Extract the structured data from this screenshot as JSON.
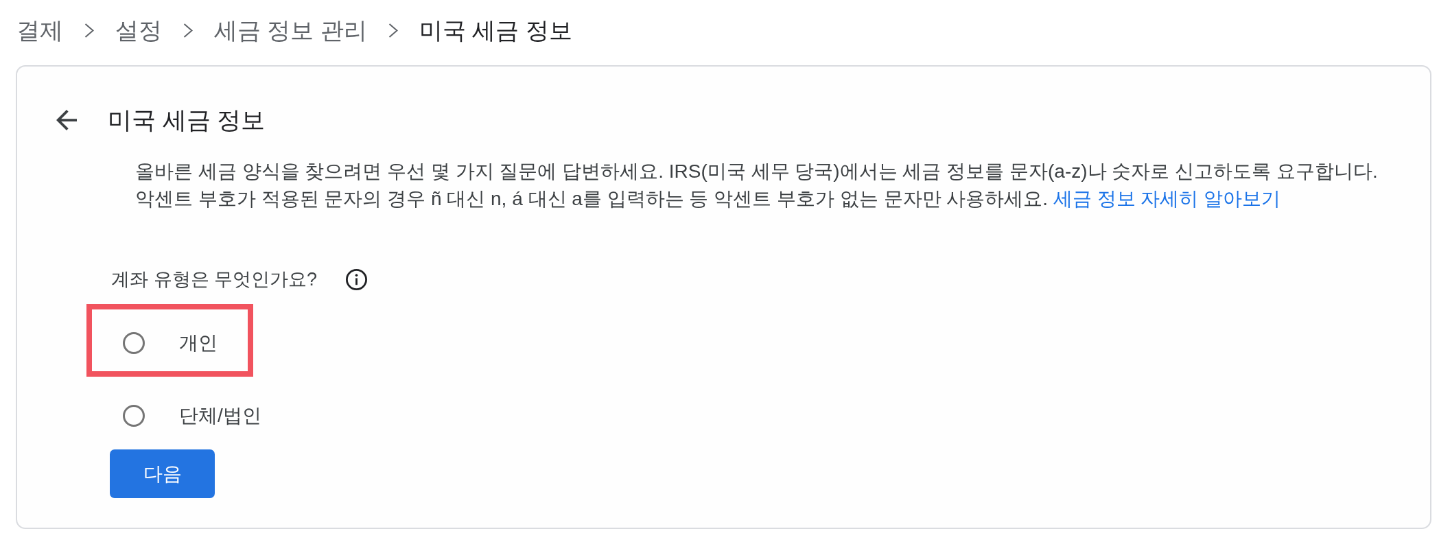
{
  "breadcrumb": [
    {
      "label": "결제",
      "current": false
    },
    {
      "label": "설정",
      "current": false
    },
    {
      "label": "세금 정보 관리",
      "current": false
    },
    {
      "label": "미국 세금 정보",
      "current": true
    }
  ],
  "card": {
    "title": "미국 세금 정보",
    "description": "올바른 세금 양식을 찾으려면 우선 몇 가지 질문에 답변하세요. IRS(미국 세무 당국)에서는 세금 정보를 문자(a-z)나 숫자로 신고하도록 요구합니다. 악센트 부호가 적용된 문자의 경우 ñ 대신 n, á 대신 a를 입력하는 등 악센트 부호가 없는 문자만 사용하세요.",
    "learn_more_link": "세금 정보 자세히 알아보기",
    "question": "계좌 유형은 무엇인가요?",
    "options": [
      {
        "label": "개인",
        "selected": false,
        "highlighted": true
      },
      {
        "label": "단체/법인",
        "selected": false,
        "highlighted": false
      }
    ],
    "next_button": "다음"
  }
}
